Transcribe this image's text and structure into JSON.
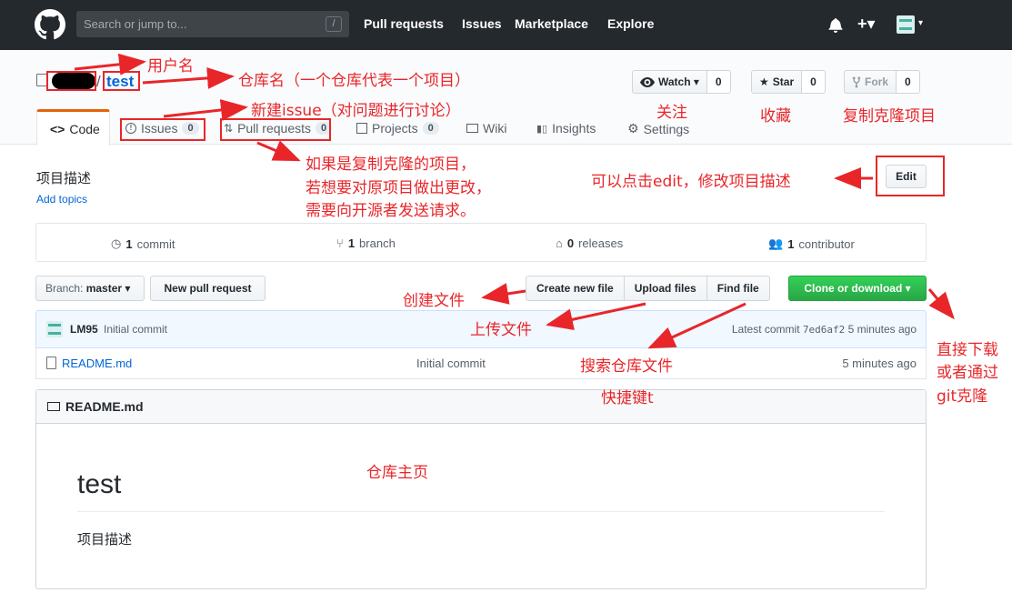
{
  "header": {
    "search_placeholder": "Search or jump to...",
    "search_shortcut": "/",
    "nav": [
      "Pull requests",
      "Issues",
      "Marketplace",
      "Explore"
    ],
    "plus": "+▾"
  },
  "repo": {
    "name": "test",
    "watch_label": "Watch ▾",
    "watch_count": "0",
    "star_label": "Star",
    "star_count": "0",
    "fork_label": "Fork",
    "fork_count": "0"
  },
  "tabs": [
    {
      "label": "Code"
    },
    {
      "label": "Issues",
      "count": "0"
    },
    {
      "label": "Pull requests",
      "count": "0"
    },
    {
      "label": "Projects",
      "count": "0"
    },
    {
      "label": "Wiki"
    },
    {
      "label": "Insights"
    },
    {
      "label": "Settings"
    }
  ],
  "about": {
    "description": "项目描述",
    "add_topics": "Add topics",
    "edit_label": "Edit"
  },
  "summary": {
    "commits_num": "1",
    "commits_label": "commit",
    "branches_num": "1",
    "branches_label": "branch",
    "releases_num": "0",
    "releases_label": "releases",
    "contributors_num": "1",
    "contributors_label": "contributor"
  },
  "toolbar": {
    "branch_prefix": "Branch:",
    "branch_name": "master ▾",
    "new_pr": "New pull request",
    "create_file": "Create new file",
    "upload_files": "Upload files",
    "find_file": "Find file",
    "clone": "Clone or download ▾"
  },
  "commit": {
    "author": "LM95",
    "message": "Initial commit",
    "latest_prefix": "Latest commit",
    "sha": "7ed6af2",
    "age": "5 minutes ago"
  },
  "files": [
    {
      "name": "README.md",
      "commit": "Initial commit",
      "age": "5 minutes ago"
    }
  ],
  "readme": {
    "filename": "README.md",
    "title": "test",
    "text": "项目描述"
  },
  "annotations": {
    "username": "用户名",
    "repo_name": "仓库名（一个仓库代表一个项目）",
    "new_issue": "新建issue（对问题进行讨论）",
    "watch": "关注",
    "star": "收藏",
    "fork": "复制克隆项目",
    "pr_line1": "如果是复制克隆的项目，",
    "pr_line2": "若想要对原项目做出更改，",
    "pr_line3": "需要向开源者发送请求。",
    "edit": "可以点击edit，修改项目描述",
    "create_file": "创建文件",
    "upload": "上传文件",
    "find_line1": "搜索仓库文件",
    "find_line2": "快捷键t",
    "clone_line1": "直接下载",
    "clone_line2": "或者通过",
    "clone_line3": "git克隆",
    "homepage": "仓库主页"
  },
  "colors": {
    "annotation": "#e8262a",
    "header_bg": "#24292e",
    "link": "#0366d6",
    "clone_green": "#28a745",
    "tab_accent": "#e36209"
  }
}
